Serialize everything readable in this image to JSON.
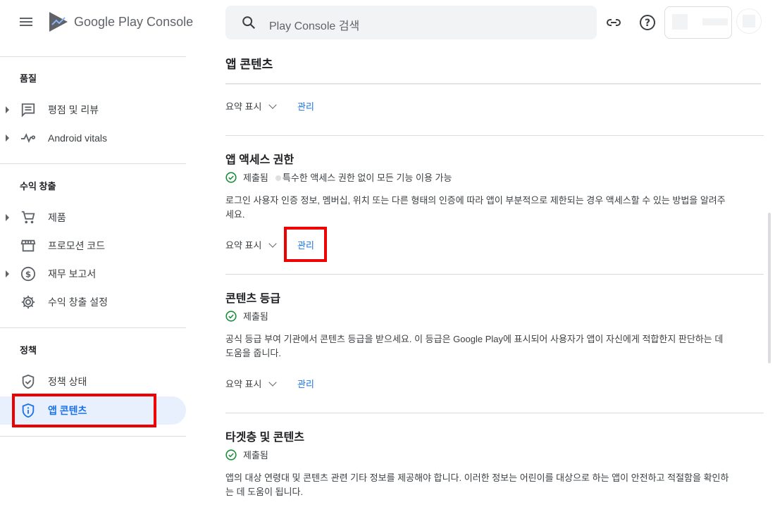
{
  "app": {
    "logo_text": "Google Play Console"
  },
  "search": {
    "placeholder": "Play Console 검색"
  },
  "sidebar": {
    "sections": [
      {
        "title": "품질"
      },
      {
        "title": "수익 창출"
      },
      {
        "title": "정책"
      }
    ],
    "items": [
      {
        "label": "평점 및 리뷰",
        "icon": "review-icon"
      },
      {
        "label": "Android vitals",
        "icon": "vitals-icon"
      },
      {
        "label": "제품",
        "icon": "cart-icon"
      },
      {
        "label": "프로모션 코드",
        "icon": "store-icon"
      },
      {
        "label": "재무 보고서",
        "icon": "dollar-icon"
      },
      {
        "label": "수익 창출 설정",
        "icon": "gear-icon"
      },
      {
        "label": "정책 상태",
        "icon": "shield-check-icon"
      },
      {
        "label": "앱 콘텐츠",
        "icon": "shield-info-icon"
      }
    ]
  },
  "main": {
    "page_title": "앱 콘텐츠",
    "summary_label": "요약 표시",
    "manage_label": "관리",
    "sections": [
      {
        "title": "앱 액세스 권한",
        "status": "제출됨",
        "status_note": "특수한 액세스 권한 없이 모든 기능 이용 가능",
        "desc_line1": "로그인 사용자 인증 정보, 멤버십, 위치 또는 다른 형태의 인증에 따라 앱이 부분적으로 제한되는 경우 액세스할 수 있는 방법을 알려주",
        "desc_line2": "세요."
      },
      {
        "title": "콘텐츠 등급",
        "status": "제출됨",
        "desc_line1": "공식 등급 부여 기관에서 콘텐츠 등급을 받으세요. 이 등급은 Google Play에 표시되어 사용자가 앱이 자신에게 적합한지 판단하는 데",
        "desc_line2": "도움을 줍니다."
      },
      {
        "title": "타겟층 및 콘텐츠",
        "status": "제출됨",
        "desc_line1": "앱의 대상 연령대 및 콘텐츠 관련 기타 정보를 제공해야 합니다. 이러한 정보는 어린이를 대상으로 하는 앱이 안전하고 적절함을 확인하",
        "desc_line2": "는 데 도움이 됩니다."
      }
    ]
  },
  "colors": {
    "accent": "#1a73e8",
    "highlight_box": "#ee0000",
    "success": "#1e8e3e"
  }
}
